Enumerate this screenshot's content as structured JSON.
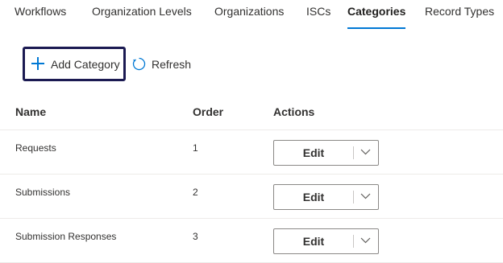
{
  "tabs": [
    {
      "label": "Workflows",
      "active": false
    },
    {
      "label": "Organization Levels",
      "active": false
    },
    {
      "label": "Organizations",
      "active": false
    },
    {
      "label": "ISCs",
      "active": false
    },
    {
      "label": "Categories",
      "active": true
    },
    {
      "label": "Record Types",
      "active": false
    }
  ],
  "toolbar": {
    "add_label": "Add Category",
    "refresh_label": "Refresh",
    "add_icon": "plus-icon",
    "refresh_icon": "refresh-icon"
  },
  "table": {
    "headers": {
      "name": "Name",
      "order": "Order",
      "actions": "Actions"
    },
    "rows": [
      {
        "name": "Requests",
        "order": "1",
        "action": "Edit"
      },
      {
        "name": "Submissions",
        "order": "2",
        "action": "Edit"
      },
      {
        "name": "Submission Responses",
        "order": "3",
        "action": "Edit"
      }
    ]
  },
  "colors": {
    "accent": "#0078d4",
    "focus_border": "#1b1a52",
    "text": "#323130"
  }
}
